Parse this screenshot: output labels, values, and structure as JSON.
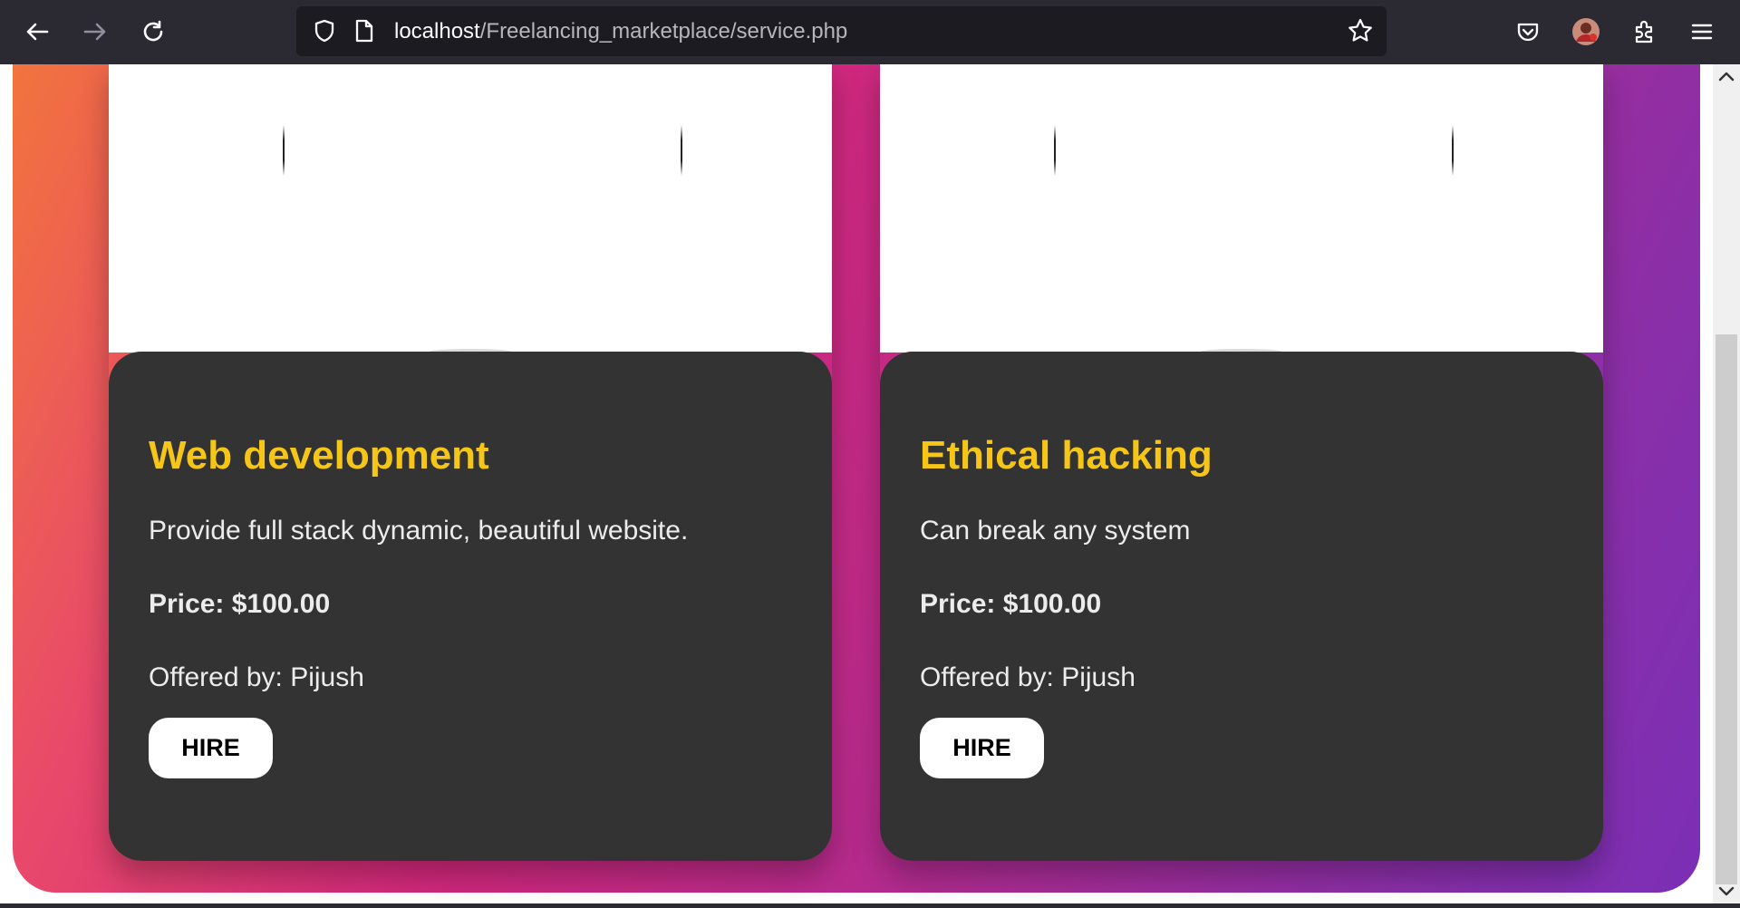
{
  "browser": {
    "url_host": "localhost",
    "url_path": "/Freelancing_marketplace/service.php"
  },
  "services": [
    {
      "title": "Web development",
      "description": "Provide full stack dynamic, beautiful website.",
      "price": "Price: $100.00",
      "offered_by": "Offered by: Pijush",
      "hire_label": "HIRE"
    },
    {
      "title": "Ethical hacking",
      "description": "Can break any system",
      "price": "Price: $100.00",
      "offered_by": "Offered by: Pijush",
      "hire_label": "HIRE"
    }
  ],
  "colors": {
    "toolbar": "#2b2a33",
    "urlbar": "#1c1b22",
    "card_body": "#333333",
    "title_accent": "#f5c518",
    "gradient_start": "#f2743d",
    "gradient_end": "#7b2fb6"
  },
  "icons": [
    "back-arrow-icon",
    "forward-arrow-icon",
    "reload-icon",
    "shield-icon",
    "page-icon",
    "star-icon",
    "pocket-icon",
    "avatar",
    "extensions-icon",
    "menu-icon"
  ]
}
